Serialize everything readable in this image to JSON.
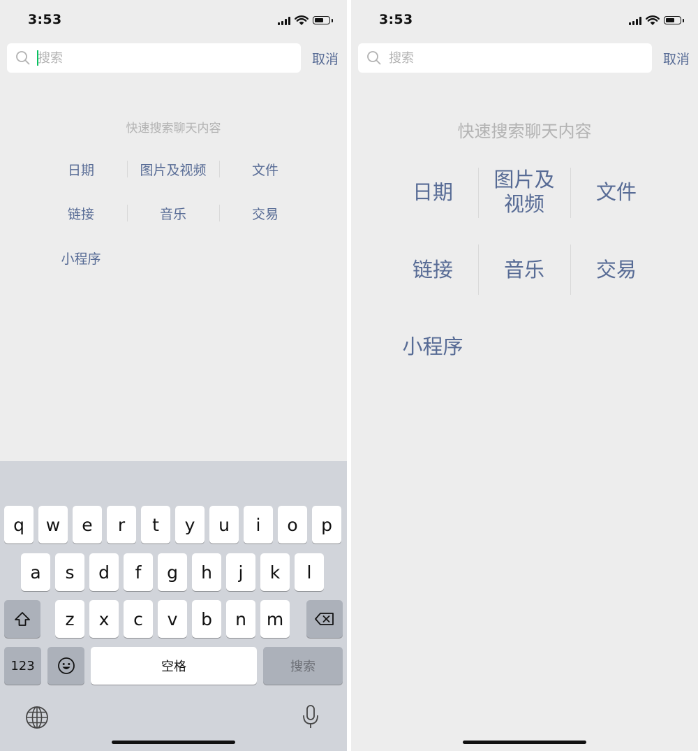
{
  "status": {
    "time": "3:53"
  },
  "search": {
    "placeholder": "搜索",
    "value": "",
    "cancel": "取消"
  },
  "quick": {
    "hint": "快速搜索聊天内容",
    "items": [
      "日期",
      "图片及视频",
      "文件",
      "链接",
      "音乐",
      "交易",
      "小程序"
    ],
    "items_right_wrapped": {
      "media_line1": "图片及",
      "media_line2": "视频"
    }
  },
  "keyboard": {
    "row1": [
      "q",
      "w",
      "e",
      "r",
      "t",
      "y",
      "u",
      "i",
      "o",
      "p"
    ],
    "row2": [
      "a",
      "s",
      "d",
      "f",
      "g",
      "h",
      "j",
      "k",
      "l"
    ],
    "row3": [
      "z",
      "x",
      "c",
      "v",
      "b",
      "n",
      "m"
    ],
    "numbers_key": "123",
    "space_key": "空格",
    "search_key": "搜索"
  },
  "colors": {
    "link": "#576b95",
    "hint": "#b3b3b3",
    "background": "#ededed",
    "keyboard": "#d1d4da"
  }
}
